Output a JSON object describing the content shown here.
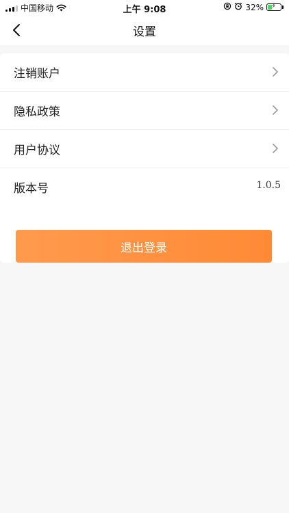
{
  "status_bar": {
    "carrier": "中国移动",
    "time": "上午 9:08",
    "battery_percent": "32%",
    "battery_level": 0.32,
    "icons": [
      "signal-icon",
      "wifi-icon",
      "rotation-lock-icon",
      "alarm-icon",
      "battery-charging-icon"
    ]
  },
  "nav": {
    "title": "设置",
    "back_icon": "chevron-left-icon"
  },
  "settings": {
    "items": [
      {
        "label": "注销账户",
        "icon": "chevron-right-icon"
      },
      {
        "label": "隐私政策",
        "icon": "chevron-right-icon"
      },
      {
        "label": "用户协议",
        "icon": "chevron-right-icon"
      },
      {
        "label": "版本号",
        "value": "1.0.5"
      }
    ]
  },
  "logout": {
    "label": "退出登录"
  },
  "colors": {
    "accent": "#ff8f3f",
    "background": "#f7f7f7",
    "card": "#ffffff",
    "divider": "#ededed"
  }
}
